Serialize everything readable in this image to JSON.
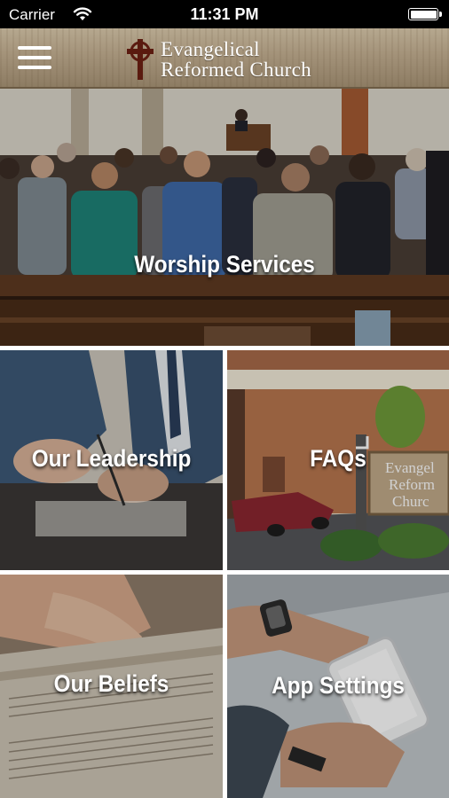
{
  "status_bar": {
    "carrier": "Carrier",
    "time": "11:31 PM",
    "wifi_icon": "wifi-icon",
    "battery_icon": "battery-icon",
    "battery_level": 1.0
  },
  "header": {
    "menu_icon": "hamburger-menu-icon",
    "logo_icon": "celtic-cross-icon",
    "logo_line1": "Evangelical",
    "logo_line2": "Reformed Church",
    "logo_color": "#5a1a0f",
    "text_color": "#ffffff"
  },
  "tiles": {
    "worship": {
      "label": "Worship Services"
    },
    "leadership": {
      "label": "Our Leadership"
    },
    "faqs": {
      "label": "FAQs",
      "sign_line1": "Evangel",
      "sign_line2": "Reform",
      "sign_line3": "Churc"
    },
    "beliefs": {
      "label": "Our Beliefs"
    },
    "settings": {
      "label": "App Settings"
    }
  }
}
